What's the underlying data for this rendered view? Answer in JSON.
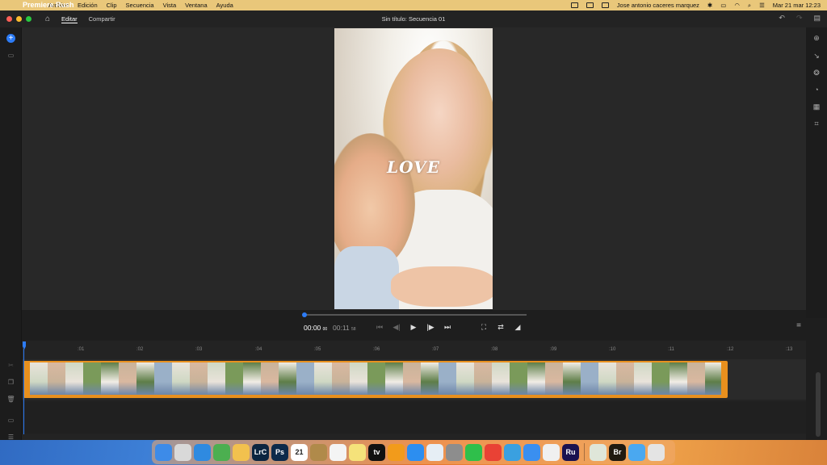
{
  "menubar": {
    "app_name": "Premiere Rush",
    "items": [
      "Archivo",
      "Edición",
      "Clip",
      "Secuencia",
      "Vista",
      "Ventana",
      "Ayuda"
    ],
    "user": "Jose antonio caceres marquez",
    "datetime": "Mar 21 mar 12:23"
  },
  "window": {
    "tabs": [
      "Editar",
      "Compartir"
    ],
    "title": "Sin título: Secuencia 01"
  },
  "preview": {
    "overlay_text": "LOVE"
  },
  "playback": {
    "current_time": "00:00",
    "current_frames": "00",
    "total_time": "00:11",
    "total_frames": "58",
    "scrub_fraction": 0.0
  },
  "timeline": {
    "ruler_ticks": [
      ":01",
      ":02",
      ":03",
      ":04",
      ":05",
      ":06",
      ":07",
      ":08",
      ":09",
      ":10",
      ":11",
      ":12",
      ":13"
    ]
  },
  "dock": {
    "apps": [
      {
        "name": "finder-icon",
        "label": "",
        "color": "#3d8be8"
      },
      {
        "name": "launchpad-icon",
        "label": "",
        "color": "#d9d9d9"
      },
      {
        "name": "safari-icon",
        "label": "",
        "color": "#2f8ae0"
      },
      {
        "name": "maps-icon",
        "label": "",
        "color": "#4caf50"
      },
      {
        "name": "photos-icon",
        "label": "",
        "color": "#f2c14e"
      },
      {
        "name": "lightroom-classic-icon",
        "label": "LrC",
        "color": "#0b2540"
      },
      {
        "name": "photoshop-icon",
        "label": "Ps",
        "color": "#0c2a4a"
      },
      {
        "name": "calendar-icon",
        "label": "21",
        "color": "#ffffff"
      },
      {
        "name": "notes-icon",
        "label": "",
        "color": "#b08a4a"
      },
      {
        "name": "reminders-icon",
        "label": "",
        "color": "#f4f4f4"
      },
      {
        "name": "notes-yellow-icon",
        "label": "",
        "color": "#f5e27a"
      },
      {
        "name": "apple-tv-icon",
        "label": "tv",
        "color": "#111111"
      },
      {
        "name": "pages-icon",
        "label": "",
        "color": "#f29b1b"
      },
      {
        "name": "app-store-icon",
        "label": "",
        "color": "#2c8ef0"
      },
      {
        "name": "preview-icon",
        "label": "",
        "color": "#e6eef5"
      },
      {
        "name": "system-settings-icon",
        "label": "",
        "color": "#8d8d8d"
      },
      {
        "name": "whatsapp-icon",
        "label": "",
        "color": "#2fbf4b"
      },
      {
        "name": "chrome-icon",
        "label": "",
        "color": "#e94235"
      },
      {
        "name": "scissors-icon",
        "label": "",
        "color": "#3aa0e0"
      },
      {
        "name": "mail-icon",
        "label": "",
        "color": "#3a8ff0"
      },
      {
        "name": "keyboard-icon",
        "label": "",
        "color": "#f0f0f0"
      },
      {
        "name": "premiere-rush-icon",
        "label": "Ru",
        "color": "#1a1250"
      },
      {
        "name": "screenshot-icon",
        "label": "",
        "color": "#dfe6d9"
      },
      {
        "name": "bridge-icon",
        "label": "Br",
        "color": "#201a10"
      },
      {
        "name": "folder-icon",
        "label": "",
        "color": "#4aa8f0"
      },
      {
        "name": "trash-icon",
        "label": "",
        "color": "#e4e4e4"
      }
    ]
  },
  "colors": {
    "accent": "#2d7cf6",
    "clip": "#e8901e",
    "menubar": "#e9c77a"
  }
}
